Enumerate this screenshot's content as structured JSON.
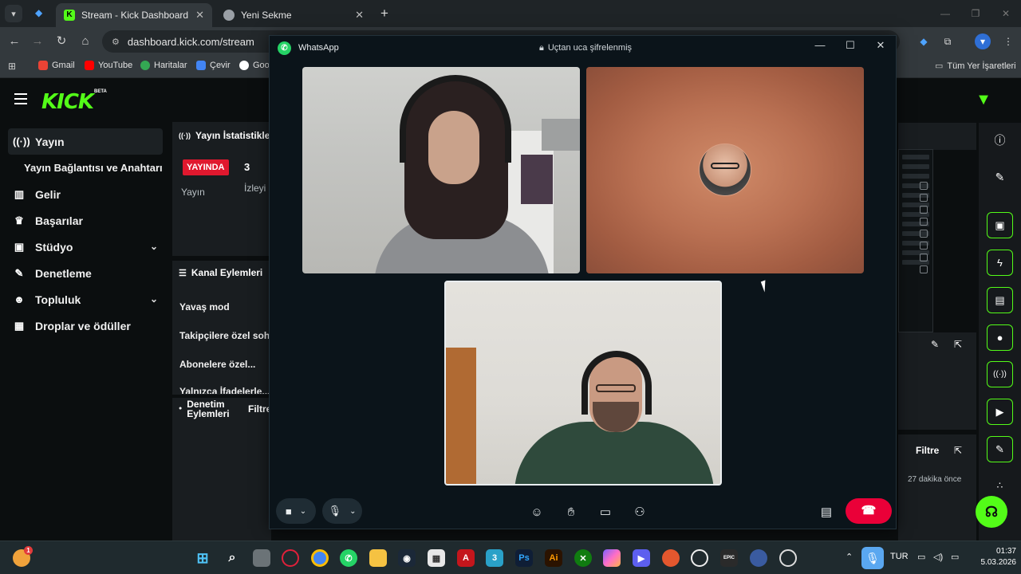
{
  "browser": {
    "tabs": [
      {
        "title": "Stream - Kick Dashboard",
        "active": true
      },
      {
        "title": "Yeni Sekme",
        "active": false
      }
    ],
    "url": "dashboard.kick.com/stream",
    "bookmarks": [
      "Gmail",
      "YouTube",
      "Haritalar",
      "Çevir",
      "Goo"
    ],
    "bookmarks_right": "Tüm Yer İşaretleri"
  },
  "kick": {
    "logo": "KICK",
    "beta": "BETA",
    "nav": [
      {
        "label": "Yayın",
        "icon": "broadcast-icon"
      },
      {
        "label": "Yayın Bağlantısı ve Anahtarı",
        "icon": ""
      },
      {
        "label": "Gelir",
        "icon": "chart-icon"
      },
      {
        "label": "Başarılar",
        "icon": "trophy-icon"
      },
      {
        "label": "Stüdyo",
        "icon": "studio-icon"
      },
      {
        "label": "Denetleme",
        "icon": "wrench-icon"
      },
      {
        "label": "Topluluk",
        "icon": "community-icon"
      },
      {
        "label": "Droplar ve ödüller",
        "icon": "gift-icon"
      }
    ],
    "stats": {
      "title": "Yayın İstatistikler",
      "live_badge": "YAYINDA",
      "viewers": "3",
      "label_stream": "Yayın",
      "label_viewers": "İzleyi"
    },
    "channel_actions": {
      "title": "Kanal Eylemleri",
      "items": [
        "Yavaş mod",
        "Takipçilere özel soh",
        "Abonelere özel...",
        "Yalnızca İfadelerle..."
      ]
    },
    "moderation": {
      "title": "Denetim Eylemleri",
      "filter": "Filtre"
    },
    "right_panel": {
      "filter": "Filtre",
      "time": "27 dakika önce"
    }
  },
  "whatsapp": {
    "app_name": "WhatsApp",
    "encryption_text": "Uçtan uca şifrelenmiş"
  },
  "taskbar": {
    "lang": "TUR",
    "time": "01:37",
    "date": "5.03.2026",
    "badge": "1"
  },
  "colors": {
    "kick_green": "#53fc18",
    "live_red": "#e0182e",
    "whatsapp_green": "#25d366",
    "end_call_red": "#ea0038"
  }
}
